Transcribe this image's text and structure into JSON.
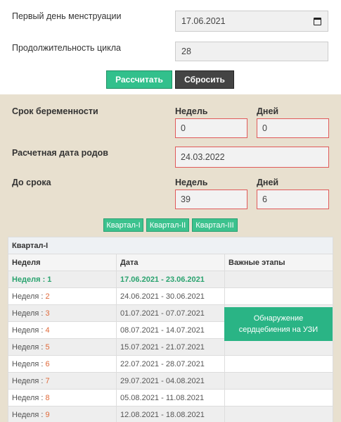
{
  "form": {
    "first_day_label": "Первый день менструации",
    "first_day_value": "17.06.2021",
    "cycle_label": "Продолжительность цикла",
    "cycle_value": "28",
    "calc_button": "Рассчитать",
    "reset_button": "Сбросить"
  },
  "result": {
    "term_label": "Срок беременности",
    "weeks_label": "Недель",
    "days_label": "Дней",
    "term_weeks": "0",
    "term_days": "0",
    "due_label": "Расчетная дата родов",
    "due_value": "24.03.2022",
    "remaining_label": "До срока",
    "remaining_weeks": "39",
    "remaining_days": "6"
  },
  "tabs": [
    "Квартал-I",
    "Квартал-II",
    "Квартал-III"
  ],
  "table": {
    "caption": "Квартал-I",
    "headers": [
      "Неделя",
      "Дата",
      "Важные этапы"
    ],
    "week_prefix": "Неделя :",
    "rows": [
      {
        "week": "1",
        "date": "17.06.2021 - 23.06.2021"
      },
      {
        "week": "2",
        "date": "24.06.2021 - 30.06.2021"
      },
      {
        "week": "3",
        "date": "01.07.2021 - 07.07.2021"
      },
      {
        "week": "4",
        "date": "08.07.2021 - 14.07.2021"
      },
      {
        "week": "5",
        "date": "15.07.2021 - 21.07.2021"
      },
      {
        "week": "6",
        "date": "22.07.2021 - 28.07.2021"
      },
      {
        "week": "7",
        "date": "29.07.2021 - 04.08.2021"
      },
      {
        "week": "8",
        "date": "05.08.2021 - 11.08.2021"
      },
      {
        "week": "9",
        "date": "12.08.2021 - 18.08.2021"
      }
    ],
    "milestone": "Обнаружение сердцебиения на УЗИ"
  }
}
